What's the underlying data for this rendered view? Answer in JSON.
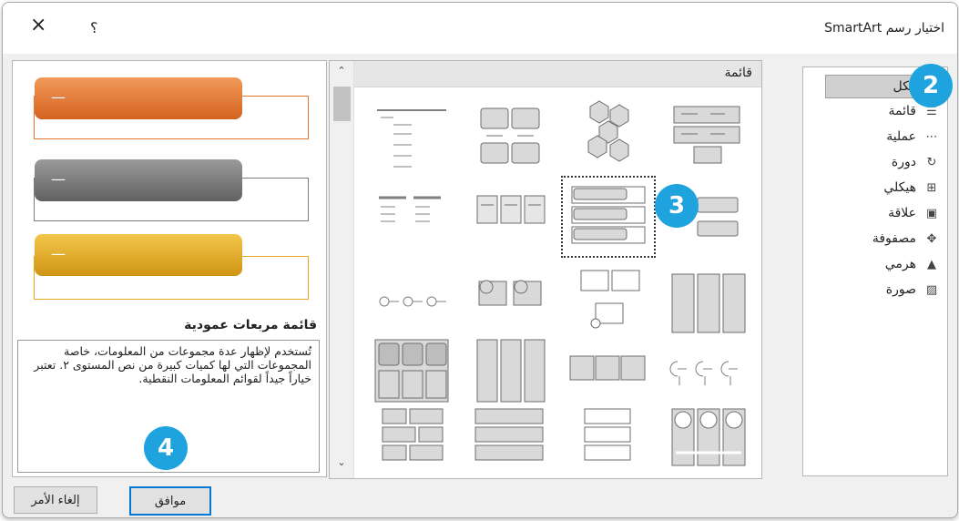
{
  "dialog": {
    "title": "اختيار رسم SmartArt",
    "close_glyph": "×",
    "help_glyph": "؟"
  },
  "categories": [
    {
      "label": "الكل",
      "icon": "all-icon",
      "selected": true
    },
    {
      "label": "قائمة",
      "icon": "list-icon"
    },
    {
      "label": "عملية",
      "icon": "process-icon"
    },
    {
      "label": "دورة",
      "icon": "cycle-icon"
    },
    {
      "label": "هيكلي",
      "icon": "hierarchy-icon"
    },
    {
      "label": "علاقة",
      "icon": "relationship-icon"
    },
    {
      "label": "مصفوفة",
      "icon": "matrix-icon"
    },
    {
      "label": "هرمي",
      "icon": "pyramid-icon"
    },
    {
      "label": "صورة",
      "icon": "picture-icon"
    }
  ],
  "gallery": {
    "header": "قائمة",
    "selected_index": 6
  },
  "preview": {
    "title": "قائمة مربعات عمودية",
    "description": "تُستخدم لإظهار عدة مجموعات من المعلومات، خاصة المجموعات التي لها كميات كبيرة من نص المستوى ٢. تعتبر خياراً جيداً لقوائم المعلومات النقطية.",
    "dash": "—",
    "colors": [
      "#e8742f",
      "#7b7b7b",
      "#e5a81d"
    ]
  },
  "buttons": {
    "ok": "موافق",
    "cancel": "إلغاء الأمر"
  },
  "badges": {
    "b2": "2",
    "b3": "3",
    "b4": "4"
  },
  "accent_color": "#1ea3de"
}
